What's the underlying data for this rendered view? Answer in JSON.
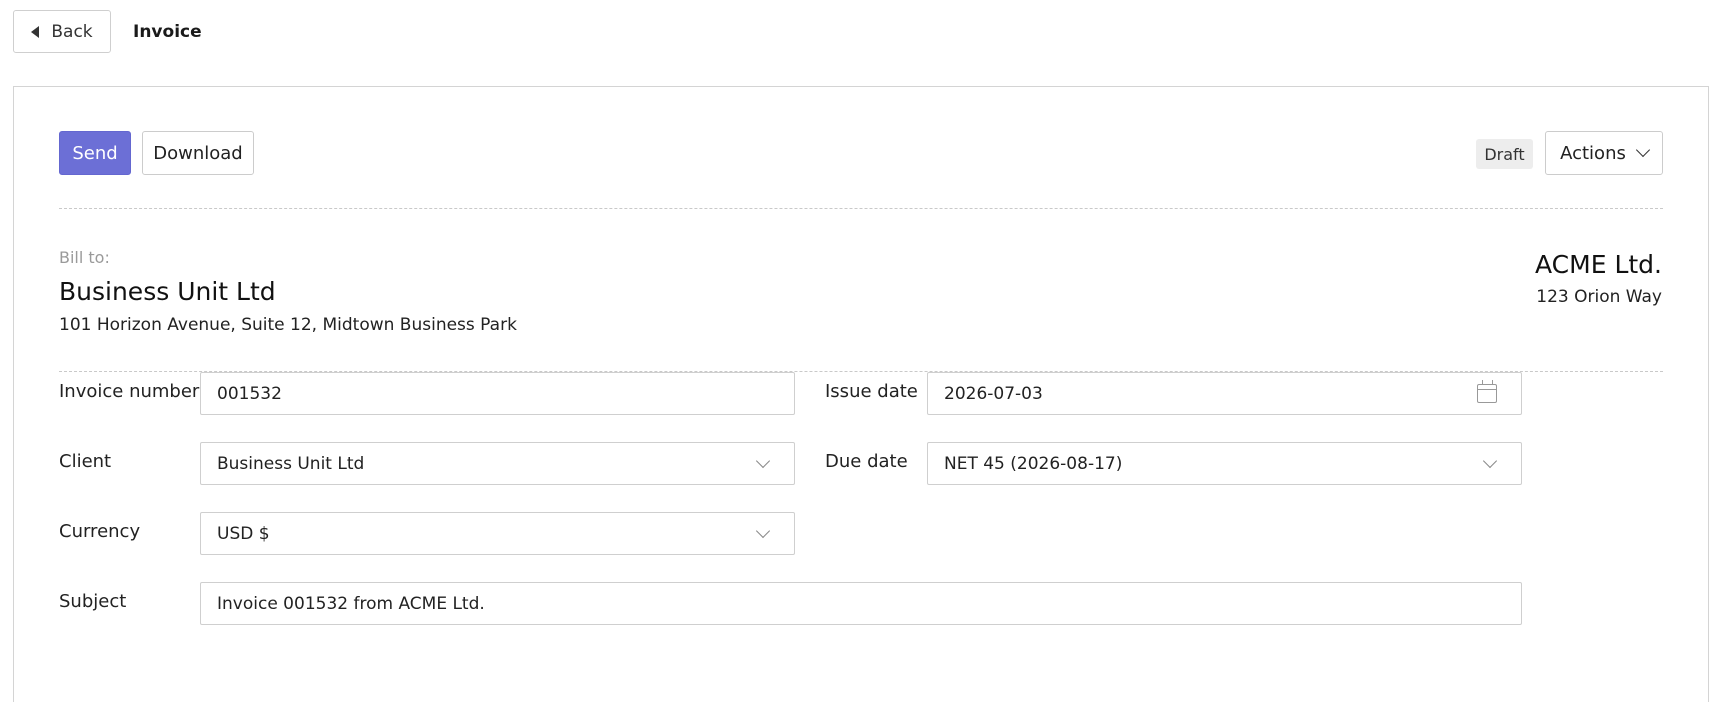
{
  "header": {
    "back_label": "Back",
    "title": "Invoice"
  },
  "toolbar": {
    "send_label": "Send",
    "download_label": "Download",
    "status_badge": "Draft",
    "actions_label": "Actions"
  },
  "bill_to": {
    "label": "Bill to:",
    "name": "Business Unit Ltd",
    "address": "101 Horizon Avenue, Suite 12, Midtown Business Park"
  },
  "company": {
    "name": "ACME Ltd.",
    "address": "123 Orion Way"
  },
  "form": {
    "invoice_number": {
      "label": "Invoice number",
      "value": "001532"
    },
    "issue_date": {
      "label": "Issue date",
      "value": "2026-07-03"
    },
    "client": {
      "label": "Client",
      "value": "Business Unit Ltd"
    },
    "due_date": {
      "label": "Due date",
      "value": "NET 45 (2026-08-17)"
    },
    "currency": {
      "label": "Currency",
      "value": "USD $"
    },
    "subject": {
      "label": "Subject",
      "value": "Invoice 001532 from ACME Ltd."
    }
  },
  "colors": {
    "accent": "#6c6fd6"
  }
}
